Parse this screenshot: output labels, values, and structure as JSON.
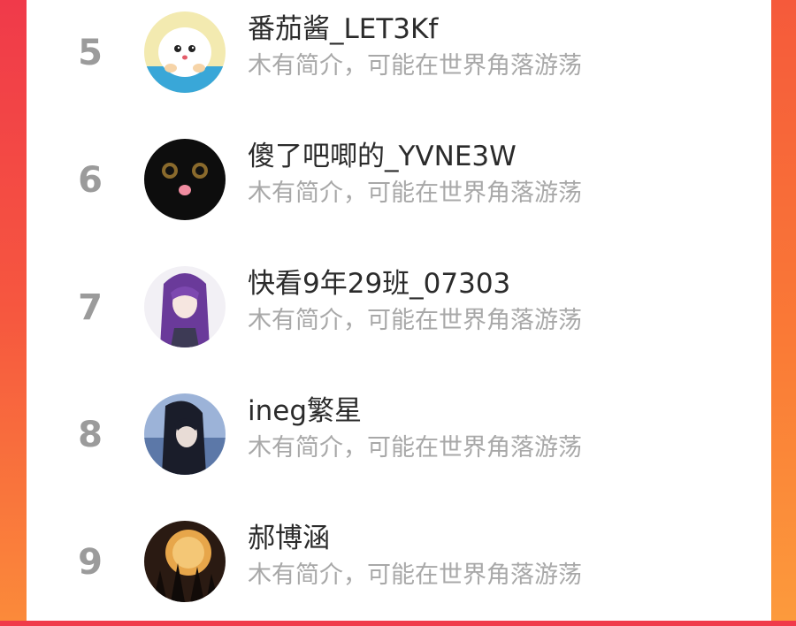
{
  "leaderboard": {
    "rows": [
      {
        "rank": "5",
        "name": "番茄酱_LET3Kf",
        "bio": "木有简介，可能在世界角落游荡",
        "avatar_icon": "cartoon-character-avatar"
      },
      {
        "rank": "6",
        "name": "傻了吧唧的_YVNE3W",
        "bio": "木有简介，可能在世界角落游荡",
        "avatar_icon": "black-cat-avatar"
      },
      {
        "rank": "7",
        "name": "快看9年29班_07303",
        "bio": "木有简介，可能在世界角落游荡",
        "avatar_icon": "anime-purple-hair-avatar"
      },
      {
        "rank": "8",
        "name": "ineg繁星",
        "bio": "木有简介，可能在世界角落游荡",
        "avatar_icon": "dark-hair-portrait-avatar"
      },
      {
        "rank": "9",
        "name": "郝博涵",
        "bio": "木有简介，可能在世界角落游荡",
        "avatar_icon": "moon-night-scene-avatar"
      }
    ]
  },
  "colors": {
    "background_top": "#f03a4a",
    "background_bottom": "#fb8a3a",
    "rank": "#9b9b9b",
    "name": "#2b2b2b",
    "bio": "#a8a8a8"
  }
}
